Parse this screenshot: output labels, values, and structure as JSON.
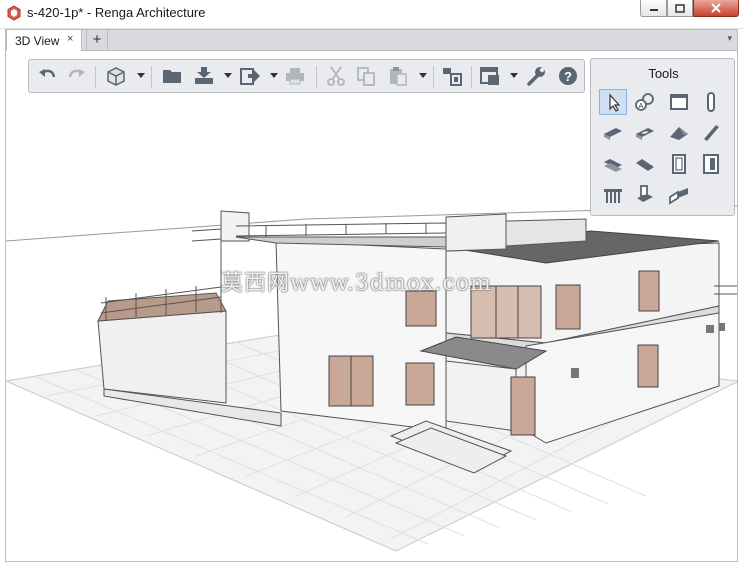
{
  "window": {
    "title": "s-420-1p* - Renga Architecture"
  },
  "tabs": [
    {
      "label": "3D View",
      "close": "×"
    }
  ],
  "tab_add": "+",
  "tab_menu": "▾",
  "toolbar": {
    "buttons": [
      "undo-icon",
      "redo-icon",
      "view-cube-icon",
      "open-folder-icon",
      "import-icon",
      "export-icon",
      "print-icon",
      "cut-icon",
      "copy-icon",
      "paste-icon",
      "levels-icon",
      "layers-icon",
      "settings-wrench-icon",
      "help-icon"
    ]
  },
  "tools_panel": {
    "title": "Tools",
    "items": [
      "select-tool-icon",
      "annotation-tool-icon",
      "wall-tool-icon",
      "column-tool-icon",
      "floor-tool-icon",
      "opening-tool-icon",
      "roof-tool-icon",
      "beam-tool-icon",
      "stair-tool-icon",
      "ramp-tool-icon",
      "window-tool-icon",
      "door-tool-icon",
      "railing-tool-icon",
      "element-tool-icon",
      "room-tool-icon"
    ],
    "active": "select-tool-icon"
  },
  "watermark": "莫西网www.3dmox.com",
  "colors": {
    "accent": "#cfe0f3",
    "close_button": "#c7422c",
    "panel": "#e9ebee"
  }
}
